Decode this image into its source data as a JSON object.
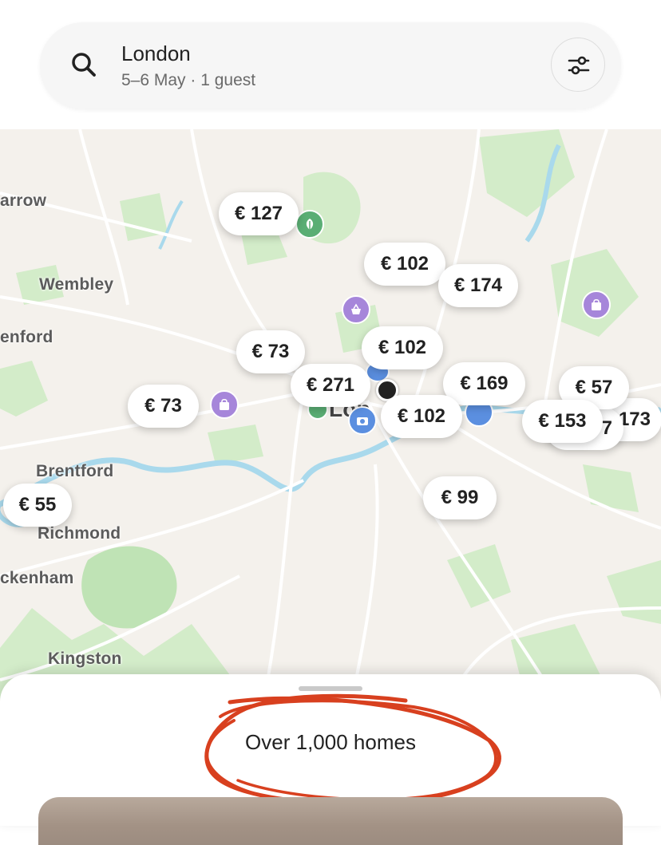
{
  "search": {
    "location": "London",
    "details": "5–6 May · 1 guest"
  },
  "icons": {
    "search": "search-icon",
    "filter": "sliders-icon",
    "park": "leaf-icon",
    "shop": "shopping-bag-icon",
    "basket": "basket-icon",
    "camera": "camera-icon",
    "current": "location-dot-icon"
  },
  "map": {
    "places": [
      "arrow",
      "Wembley",
      "enford",
      "Brentford",
      "Richmond",
      "ckenham",
      "Kingston",
      "Lon"
    ],
    "prices": [
      "€ 127",
      "€ 102",
      "€ 174",
      "€ 73",
      "€ 102",
      "€ 271",
      "€ 169",
      "€ 57",
      "€ 73",
      "€ 102",
      "€ 153",
      "€ 55",
      "€ 99",
      "173",
      "7"
    ]
  },
  "sheet": {
    "count": "Over 1,000 homes"
  },
  "colors": {
    "park_green": "#cdebc4",
    "water": "#a9d9ec",
    "poi_purple": "#a686da",
    "poi_green": "#5aae74",
    "poi_blue": "#5b8fe0",
    "annotation_red": "#d8401f"
  }
}
